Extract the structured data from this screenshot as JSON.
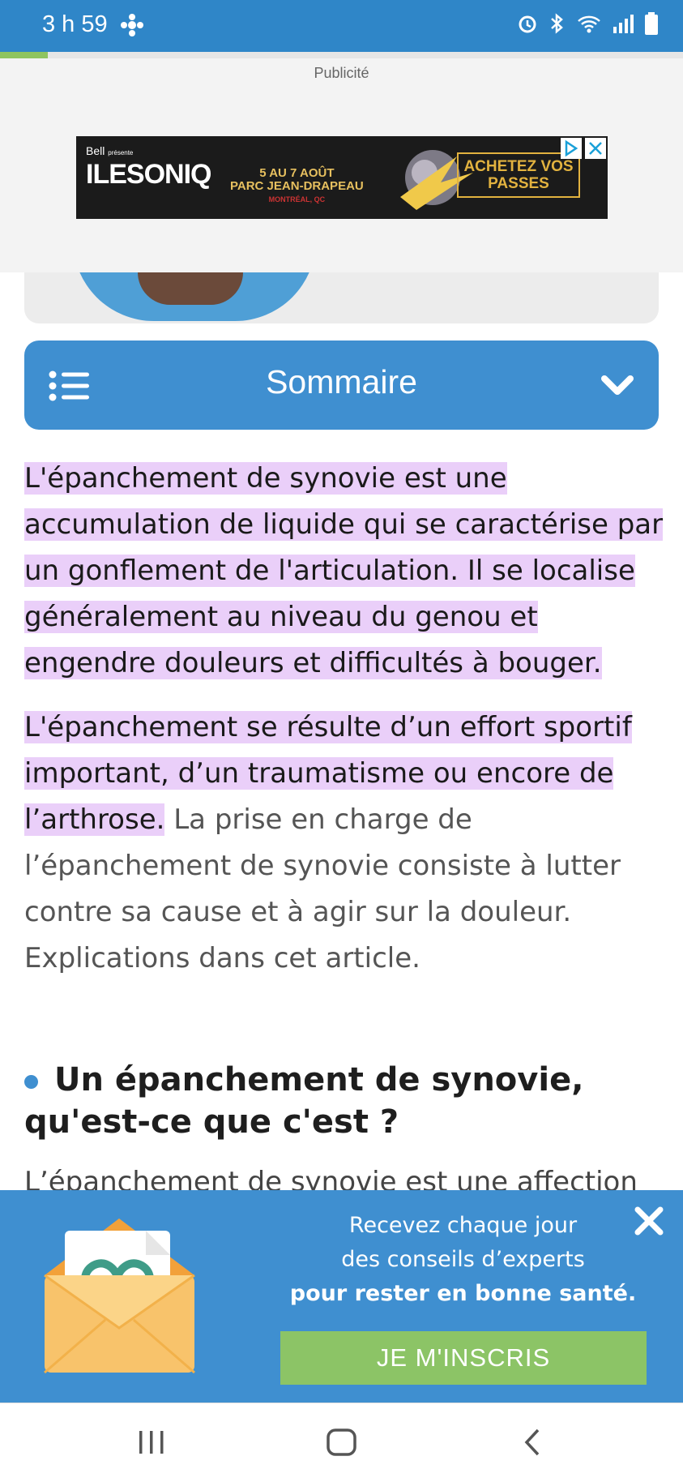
{
  "status_bar": {
    "time": "3 h 59",
    "bg_color": "#2f86c8",
    "icons": [
      "cbc-radio-canada-icon",
      "alarm-icon",
      "bluetooth-icon",
      "wifi-icon",
      "signal-icon",
      "battery-icon"
    ]
  },
  "reading_progress": 0.07,
  "ad": {
    "label": "Publicité",
    "banner": {
      "brand": "Bell",
      "presents": "présente",
      "logo": "ILESONIQ",
      "dates": "5 AU 7 AOÛT",
      "venue": "PARC JEAN-DRAPEAU",
      "city": "MONTRÉAL, QC",
      "cta": "ACHETEZ VOS PASSES"
    }
  },
  "summary": {
    "title": "Sommaire",
    "color": "#3f8fd0"
  },
  "article": {
    "p1_highlighted": "L'épanchement de synovie est une accumulation de liquide qui se caractérise par un gonflement de l'articulation. Il se localise généralement au niveau du genou et engendre douleurs et difficultés à bouger.",
    "p2_highlighted": "L'épanchement se résulte d’un effort sportif important, d’un traumatisme ou encore de l’arthrose.",
    "p2_rest": " La prise en charge de l’épanchement de synovie consiste à lutter contre sa cause et à agir sur la douleur. Explications dans cet article.",
    "heading": "Un épanchement de synovie, qu'est-ce que c'est ?",
    "truncated_line": "L’épanchement de synovie est une affection",
    "highlight_color": "#eacff9"
  },
  "newsletter": {
    "line1": "Recevez chaque jour",
    "line2": "des conseils d’experts",
    "line3": "pour rester en bonne santé.",
    "button": "JE M'INSCRIS",
    "bg_color": "#3f8fd0",
    "button_color": "#8cc466"
  },
  "nav": {
    "items": [
      "recent-apps",
      "home",
      "back"
    ]
  }
}
